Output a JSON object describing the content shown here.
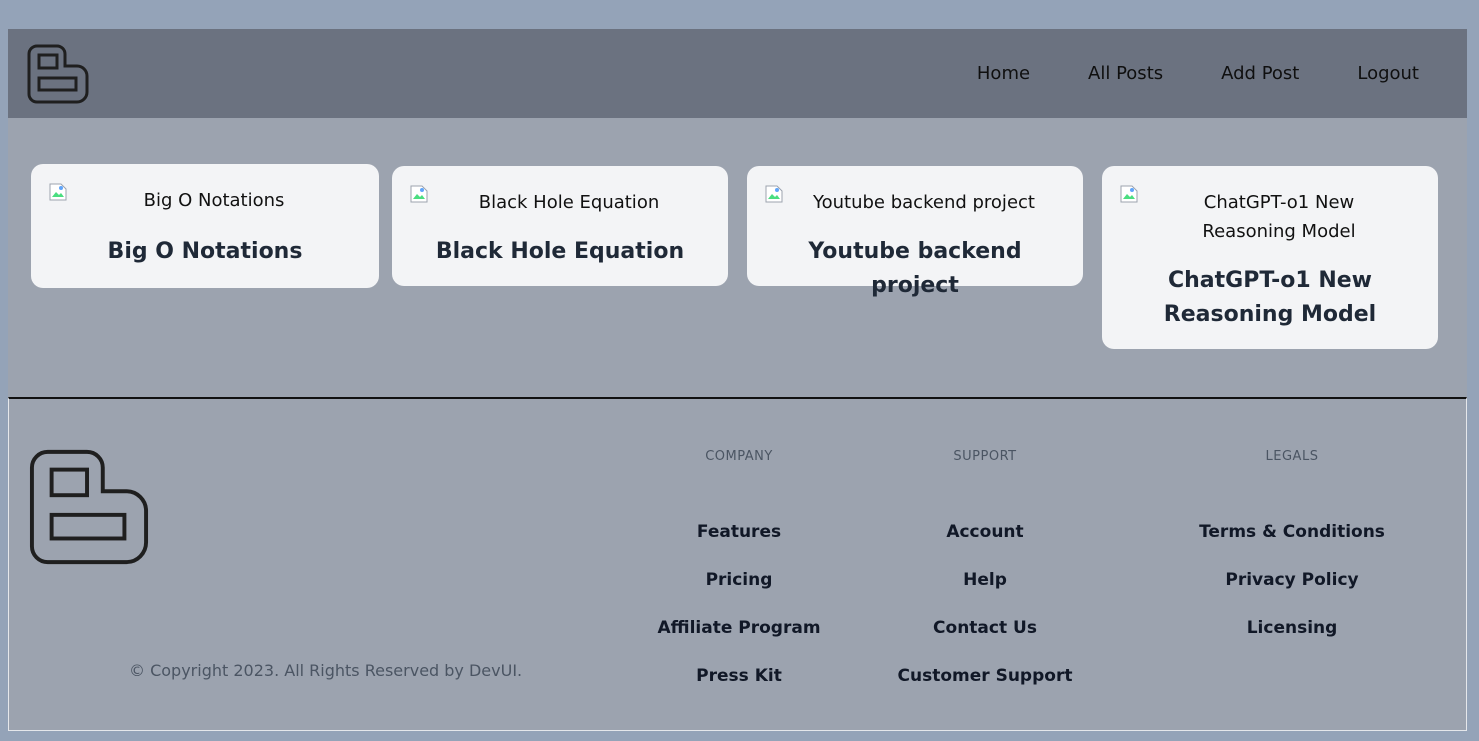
{
  "nav": {
    "items": [
      "Home",
      "All Posts",
      "Add Post",
      "Logout"
    ]
  },
  "posts": [
    {
      "alt": "Big O Notations",
      "title": "Big O Notations"
    },
    {
      "alt": "Black Hole Equation",
      "title": "Black Hole Equation"
    },
    {
      "alt": "Youtube backend project",
      "title": "Youtube backend project"
    },
    {
      "alt": "ChatGPT-o1 New Reasoning Model",
      "title": "ChatGPT-o1 New Reasoning Model"
    }
  ],
  "footer": {
    "copyright": "© Copyright 2023. All Rights Reserved by DevUI.",
    "columns": [
      {
        "heading": "COMPANY",
        "links": [
          "Features",
          "Pricing",
          "Affiliate Program",
          "Press Kit"
        ]
      },
      {
        "heading": "SUPPORT",
        "links": [
          "Account",
          "Help",
          "Contact Us",
          "Customer Support"
        ]
      },
      {
        "heading": "LEGALS",
        "links": [
          "Terms & Conditions",
          "Privacy Policy",
          "Licensing"
        ]
      }
    ]
  },
  "colors": {
    "page_bg": "#94a3b8",
    "header_bg": "#6b7280",
    "content_bg": "#9ca3af",
    "card_bg": "#f3f4f6"
  }
}
